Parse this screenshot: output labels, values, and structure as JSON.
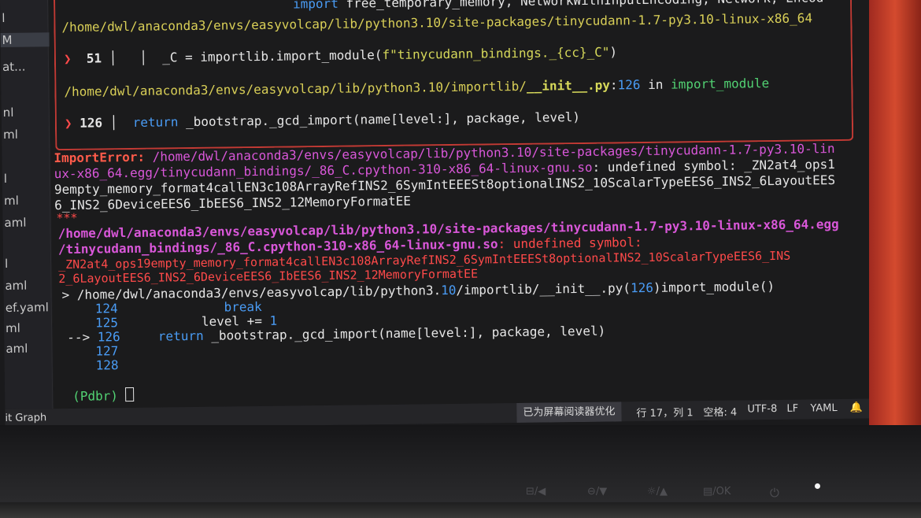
{
  "sidebar": {
    "items": [
      {
        "label": "l"
      },
      {
        "label": "M"
      },
      {
        "label": "at..."
      },
      {
        "label": "nl"
      },
      {
        "label": "ml"
      },
      {
        "label": "l"
      },
      {
        "label": "ml"
      },
      {
        "label": "aml"
      },
      {
        "label": "l"
      },
      {
        "label": "aml"
      },
      {
        "label": "ef.yaml"
      },
      {
        "label": "ml"
      },
      {
        "label": "aml"
      }
    ],
    "git_graph": "it Graph"
  },
  "frame": {
    "line0": {
      "pre": "import ",
      "text": "free_temporary_memory, NetworkWithInputEncoding, Network, Encod"
    },
    "line1": "/home/dwl/anaconda3/envs/easyvolcap/lib/python3.10/site-packages/tinycudann-1.7-py3.10-linux-x86_64",
    "line2": {
      "marker": "❯",
      "num": "51",
      "bars": "│   │",
      "code": "_C = importlib.import_module(",
      "str": "f\"tinycudann_bindings._{cc}_C\"",
      "close": ")"
    },
    "line3": {
      "path": "/home/dwl/anaconda3/envs/easyvolcap/lib/python3.10/importlib/",
      "file": "__init__.py",
      "colon": ":",
      "lineno": "126",
      "in": " in ",
      "func": "import_module"
    },
    "line4": {
      "marker": "❯",
      "num": "126",
      "bar": "│",
      "kw": "return",
      "code": " _bootstrap._gcd_import(name[level:], package, level)"
    }
  },
  "error": {
    "label": "ImportError:",
    "path1": " /home/dwl/anaconda3/envs/easyvolcap/lib/python3.10/site-packages/tinycudann-1.7-py3.10-lin",
    "path2": "ux-x86_64.egg/tinycudann_bindings/_86_C.cpython-310-x86_64-linux-gnu.so",
    "rest2": ": undefined symbol: _ZN2at4_ops1",
    "line3": "9empty_memory_format4callEN3c108ArrayRefINS2_6SymIntEEESt8optionalINS2_10ScalarTypeEES6_INS2_6LayoutEES",
    "line4": "6_INS2_6DeviceEES6_IbEES6_INS2_12MemoryFormatEE",
    "stars": "***",
    "line6": "/home/dwl/anaconda3/envs/easyvolcap/lib/python3.10/site-packages/tinycudann-1.7-py3.10-linux-x86_64.egg",
    "line7_path": "/tinycudann_bindings/_86_C.cpython-310-x86_64-linux-gnu.so",
    "line7_rest": ": undefined symbol:",
    "line8": "_ZN2at4_ops19empty_memory_format4callEN3c108ArrayRefINS2_6SymIntEEESt8optionalINS2_10ScalarTypeEES6_INS",
    "line9": "2_6LayoutEES6_INS2_6DeviceEES6_IbEES6_INS2_12MemoryFormatEE"
  },
  "pdb": {
    "where_a": "> /home/dwl/anaconda3/envs/easyvolcap/lib/python3.",
    "where_ver": "10",
    "where_b": "/importlib/__init__.py(",
    "where_line": "126",
    "where_c": ")import_module()",
    "l124_num": "124",
    "l124_code": "break",
    "l125_num": "125",
    "l125_code": "level += ",
    "l125_val": "1",
    "arrow": "-->",
    "l126_num": "126",
    "l126_kw": "return",
    "l126_code": " _bootstrap._gcd_import(name[level:], package, level)",
    "l127_num": "127",
    "l128_num": "128",
    "prompt": "(Pdbr)"
  },
  "statusbar": {
    "screen_reader": "已为屏幕阅读器优化",
    "position": "行 17，列 1",
    "spaces": "空格: 4",
    "encoding": "UTF-8",
    "eol": "LF",
    "language": "YAML"
  },
  "bezel": {
    "btn1": "⊟/◀",
    "btn2": "⊖/▼",
    "btn3": "☼/▲",
    "btn4": "▤/OK",
    "power": "⏻"
  }
}
